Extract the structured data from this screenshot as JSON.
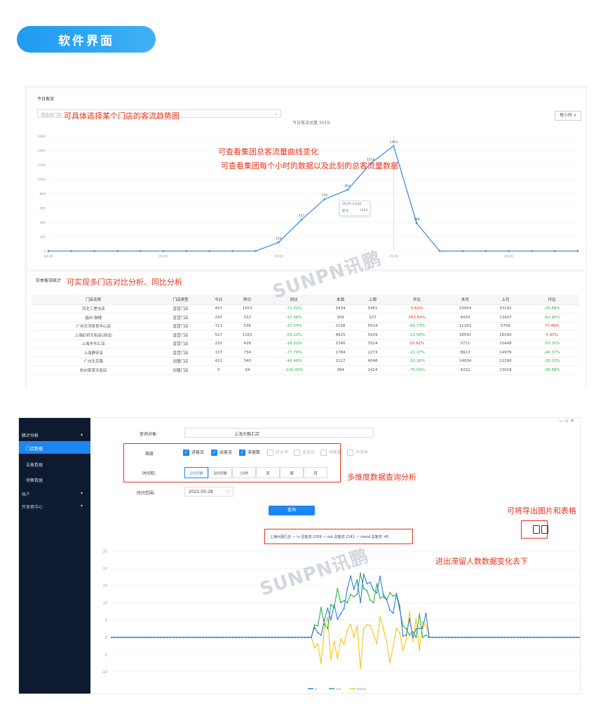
{
  "header": {
    "title": "软件界面"
  },
  "shot1": {
    "card_title": "今日客流",
    "select_placeholder": "请选择门店",
    "chart_title": "今日客流总量 3019",
    "range_button": "每小时 ∨",
    "tooltip": {
      "title": "05/29 14:00",
      "series": "客流",
      "value": "1463"
    },
    "table_card_title": "实体客流统计",
    "annotations": {
      "select": "可具体选择某个门店的客流趋势图",
      "curve": "可查看集团总客流量曲线变化",
      "hourly": "可查看集团每个小时的数据以及此刻的总客流量数据",
      "compare": "可实现多门店对比分析、同比分析"
    },
    "watermark": "SUNPN讯鹏",
    "table_headers": [
      "门店名称",
      "门店类型",
      "今日",
      "昨日",
      "同比",
      "本周",
      "上周",
      "环比",
      "本月",
      "上月",
      "环比"
    ],
    "rows": [
      [
        "河北三里屯店",
        "直营门店",
        "457",
        "1053",
        "-71.02%",
        "3434",
        "5451",
        "5.62%",
        "23454",
        "33192",
        "-25.88%"
      ],
      [
        "福州 鼓楼",
        "直营门店",
        "247",
        "332",
        "-37.36%",
        "358",
        "227",
        "263.64%",
        "4430",
        "13437",
        "-62.95%"
      ],
      [
        "广州天河体育中心店",
        "直营门店",
        "711",
        "536",
        "-37.24%",
        "2158",
        "5914",
        "-60.73%",
        "11163",
        "5756",
        "77.49%"
      ],
      [
        "上海虹桥天街店(测试)",
        "直营门店",
        "527",
        "1161",
        "-59.22%",
        "4825",
        "5929",
        "-12.58%",
        "18542",
        "18140",
        "5.93%"
      ],
      [
        "上海华东汇店",
        "直营门店",
        "220",
        "428",
        "-16.02%",
        "2346",
        "3324",
        "29.92%",
        "5721",
        "10448",
        "-55.30%"
      ],
      [
        "上海静安店",
        "直营门店",
        "137",
        "734",
        "-77.79%",
        "1784",
        "2273",
        "-21.27%",
        "8913",
        "14976",
        "-40.37%"
      ],
      [
        "广州北京路",
        "加盟门店",
        "422",
        "340",
        "-46.48%",
        "2127",
        "4048",
        "-20.26%",
        "14034",
        "22290",
        "-30.02%"
      ],
      [
        "杭州某某天街店",
        "加盟门店",
        "3",
        "34",
        "-100.00%",
        "384",
        "1424",
        "-75.00%",
        "4232",
        "23018",
        "-56.88%"
      ]
    ]
  },
  "chart_data": [
    {
      "type": "line",
      "title": "今日客流总量 3019",
      "x": [
        "00:00",
        "01:00",
        "02:00",
        "03:00",
        "04:00",
        "05:00",
        "06:00",
        "07:00",
        "08:00",
        "09:00",
        "10:00",
        "11:00",
        "12:00",
        "13:00",
        "14:00",
        "15:00",
        "16:00",
        "17:00",
        "18:00",
        "19:00",
        "20:00",
        "21:00",
        "22:00",
        "23:00"
      ],
      "series": [
        {
          "name": "客流",
          "values": [
            0,
            0,
            0,
            0,
            0,
            0,
            0,
            0,
            0,
            0,
            120,
            437,
            720,
            852,
            1219,
            1463,
            388,
            0,
            0,
            0,
            0,
            0,
            0,
            0
          ]
        }
      ],
      "ylim": [
        0,
        1600
      ],
      "grid": true,
      "color": "#3d8fe0"
    },
    {
      "type": "line",
      "title": "上海大融汇店",
      "series": [
        {
          "name": "in",
          "color": "#2e7fe2"
        },
        {
          "name": "out",
          "color": "#2bb24c"
        },
        {
          "name": "stand",
          "color": "#f5c518"
        }
      ],
      "ylim": [
        -10,
        25
      ],
      "grid": true
    }
  ],
  "shot2": {
    "sidebar": {
      "group": "统计分析",
      "items": [
        "门店数据",
        "设备数据",
        "销售数据"
      ],
      "account": "账户",
      "center": "开发者中心"
    },
    "query_label": "查询对象:",
    "query_value": "上海大融汇店",
    "dim_label": "维度",
    "dims_on": [
      "进客流",
      "出客流",
      "滞留数"
    ],
    "dims_off": [
      "转化率",
      "客单价",
      "销售额",
      "坪效率"
    ],
    "gran_label": "时间粒:",
    "granularity": [
      "10分钟",
      "30分钟",
      "小时",
      "天",
      "周",
      "月"
    ],
    "date_label": "时间范围:",
    "date_value": "2021-05-28",
    "query_button": "查询",
    "summary": "上海大融汇店 — in 总客流 2209 — out 总客流 2141 — stand 总客流 -45",
    "annotations": {
      "multi": "多维度数据查询分析",
      "export": "可将导出图片和表格",
      "stand": "进出滞留人数数据变化去下"
    },
    "watermark": "SUNPN讯鹏",
    "legend": [
      "in",
      "out",
      "stand"
    ]
  }
}
